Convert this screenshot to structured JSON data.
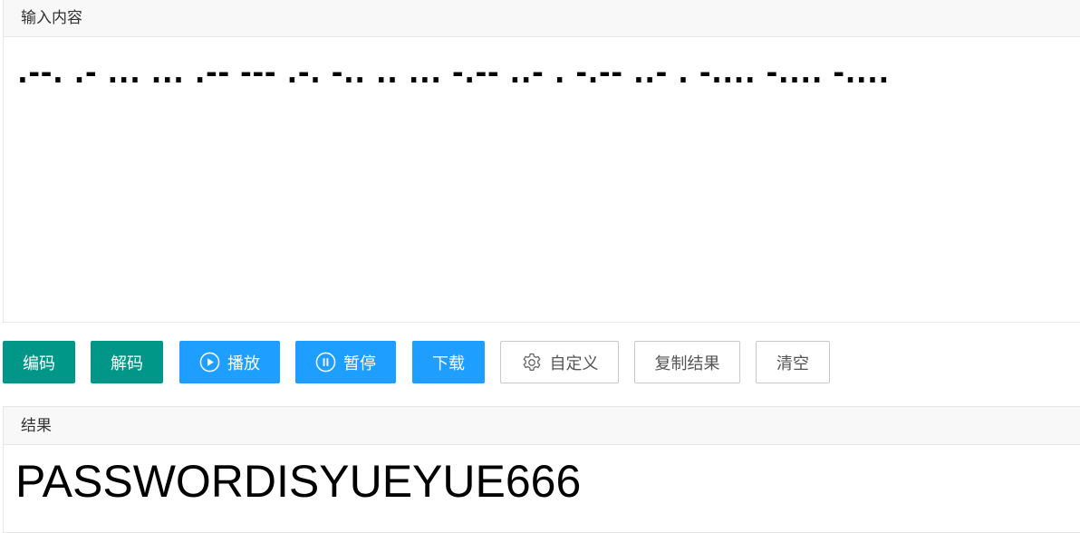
{
  "input": {
    "header": "输入内容",
    "value": ".--. .- ... ... .-- --- .-. -.. .. ... -.-- ..- . -.-- ..- . -.... -.... -...."
  },
  "toolbar": {
    "encode_label": "编码",
    "decode_label": "解码",
    "play_label": "播放",
    "pause_label": "暂停",
    "download_label": "下载",
    "custom_label": "自定义",
    "copy_label": "复制结果",
    "clear_label": "清空"
  },
  "result": {
    "header": "结果",
    "value": "PASSWORDISYUEYUE666"
  },
  "icons": {
    "play": "play-circle-icon",
    "pause": "pause-circle-icon",
    "custom": "gear-icon"
  },
  "colors": {
    "teal": "#009688",
    "blue": "#1e9fff",
    "border": "#e6e6e6"
  }
}
